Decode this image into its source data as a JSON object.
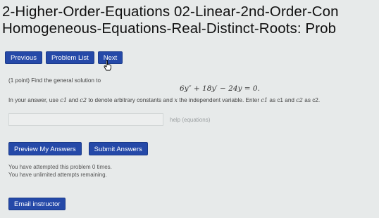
{
  "header": {
    "title_line1": "2-Higher-Order-Equations 02-Linear-2nd-Order-Con",
    "title_line2": "Homogeneous-Equations-Real-Distinct-Roots: Prob"
  },
  "nav": {
    "previous_label": "Previous",
    "problem_list_label": "Problem List",
    "next_label": "Next"
  },
  "problem": {
    "prompt": "(1 point) Find the general solution to",
    "equation": "6y″ + 18y′ − 24y = 0.",
    "instruction_start": "In your answer, use ",
    "c1": "c1",
    "instruction_and": " and ",
    "c2": "c2",
    "instruction_mid": " to denote arbitrary constants and ",
    "x": "x",
    "instruction_mid2": " the independent variable. Enter ",
    "c1b": "c1",
    "instruction_as1": " as c1 and ",
    "c2b": "c2",
    "instruction_end": " as c2.",
    "help_link": "help (equations)"
  },
  "answer": {
    "value": "",
    "placeholder": ""
  },
  "actions": {
    "preview_label": "Preview My Answers",
    "submit_label": "Submit Answers"
  },
  "status": {
    "attempts_line": "You have attempted this problem 0 times.",
    "remaining_line": "You have unlimited attempts remaining."
  },
  "footer": {
    "email_label": "Email instructor"
  },
  "colors": {
    "button_bg": "#2549a8",
    "page_bg": "#e7eaea"
  }
}
